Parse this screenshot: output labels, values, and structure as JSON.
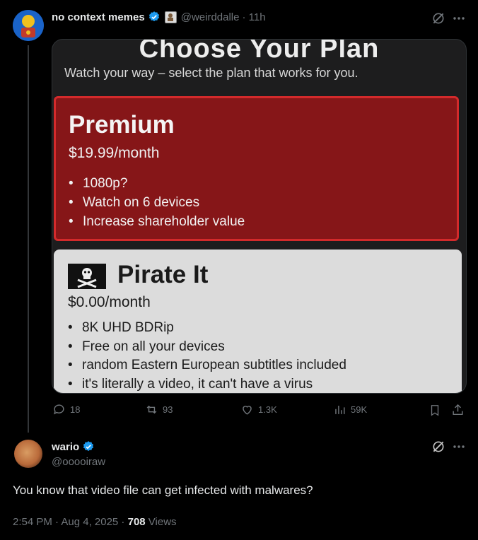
{
  "tweet": {
    "author_name": "no context memes",
    "author_handle": "@weirddalle",
    "time": "· 11h",
    "stats": {
      "replies": "18",
      "retweets": "93",
      "likes": "1.3K",
      "views": "59K"
    },
    "media": {
      "title": "Choose Your Plan",
      "subtitle": "Watch your way – select the plan that works for you.",
      "premium": {
        "name": "Premium",
        "price": "$19.99/month",
        "features": [
          "1080p?",
          "Watch on 6 devices",
          "Increase shareholder value"
        ]
      },
      "pirate": {
        "name": "Pirate It",
        "price": "$0.00/month",
        "features": [
          "8K UHD BDRip",
          "Free on all your devices",
          "random Eastern European subtitles included",
          "it's literally a video, it can't have a virus"
        ]
      }
    }
  },
  "reply": {
    "author_name": "wario",
    "author_handle": "@ooooiraw",
    "text": "You know that video file can get infected with malwares?",
    "timestamp": "2:54 PM · Aug 4, 2025 · ",
    "views_count": "708",
    "views_label": " Views"
  },
  "colors": {
    "verified": "#1d9bf0",
    "premium_bg": "#861618",
    "pirate_bg": "#dcdcdc",
    "muted": "#71767b"
  }
}
